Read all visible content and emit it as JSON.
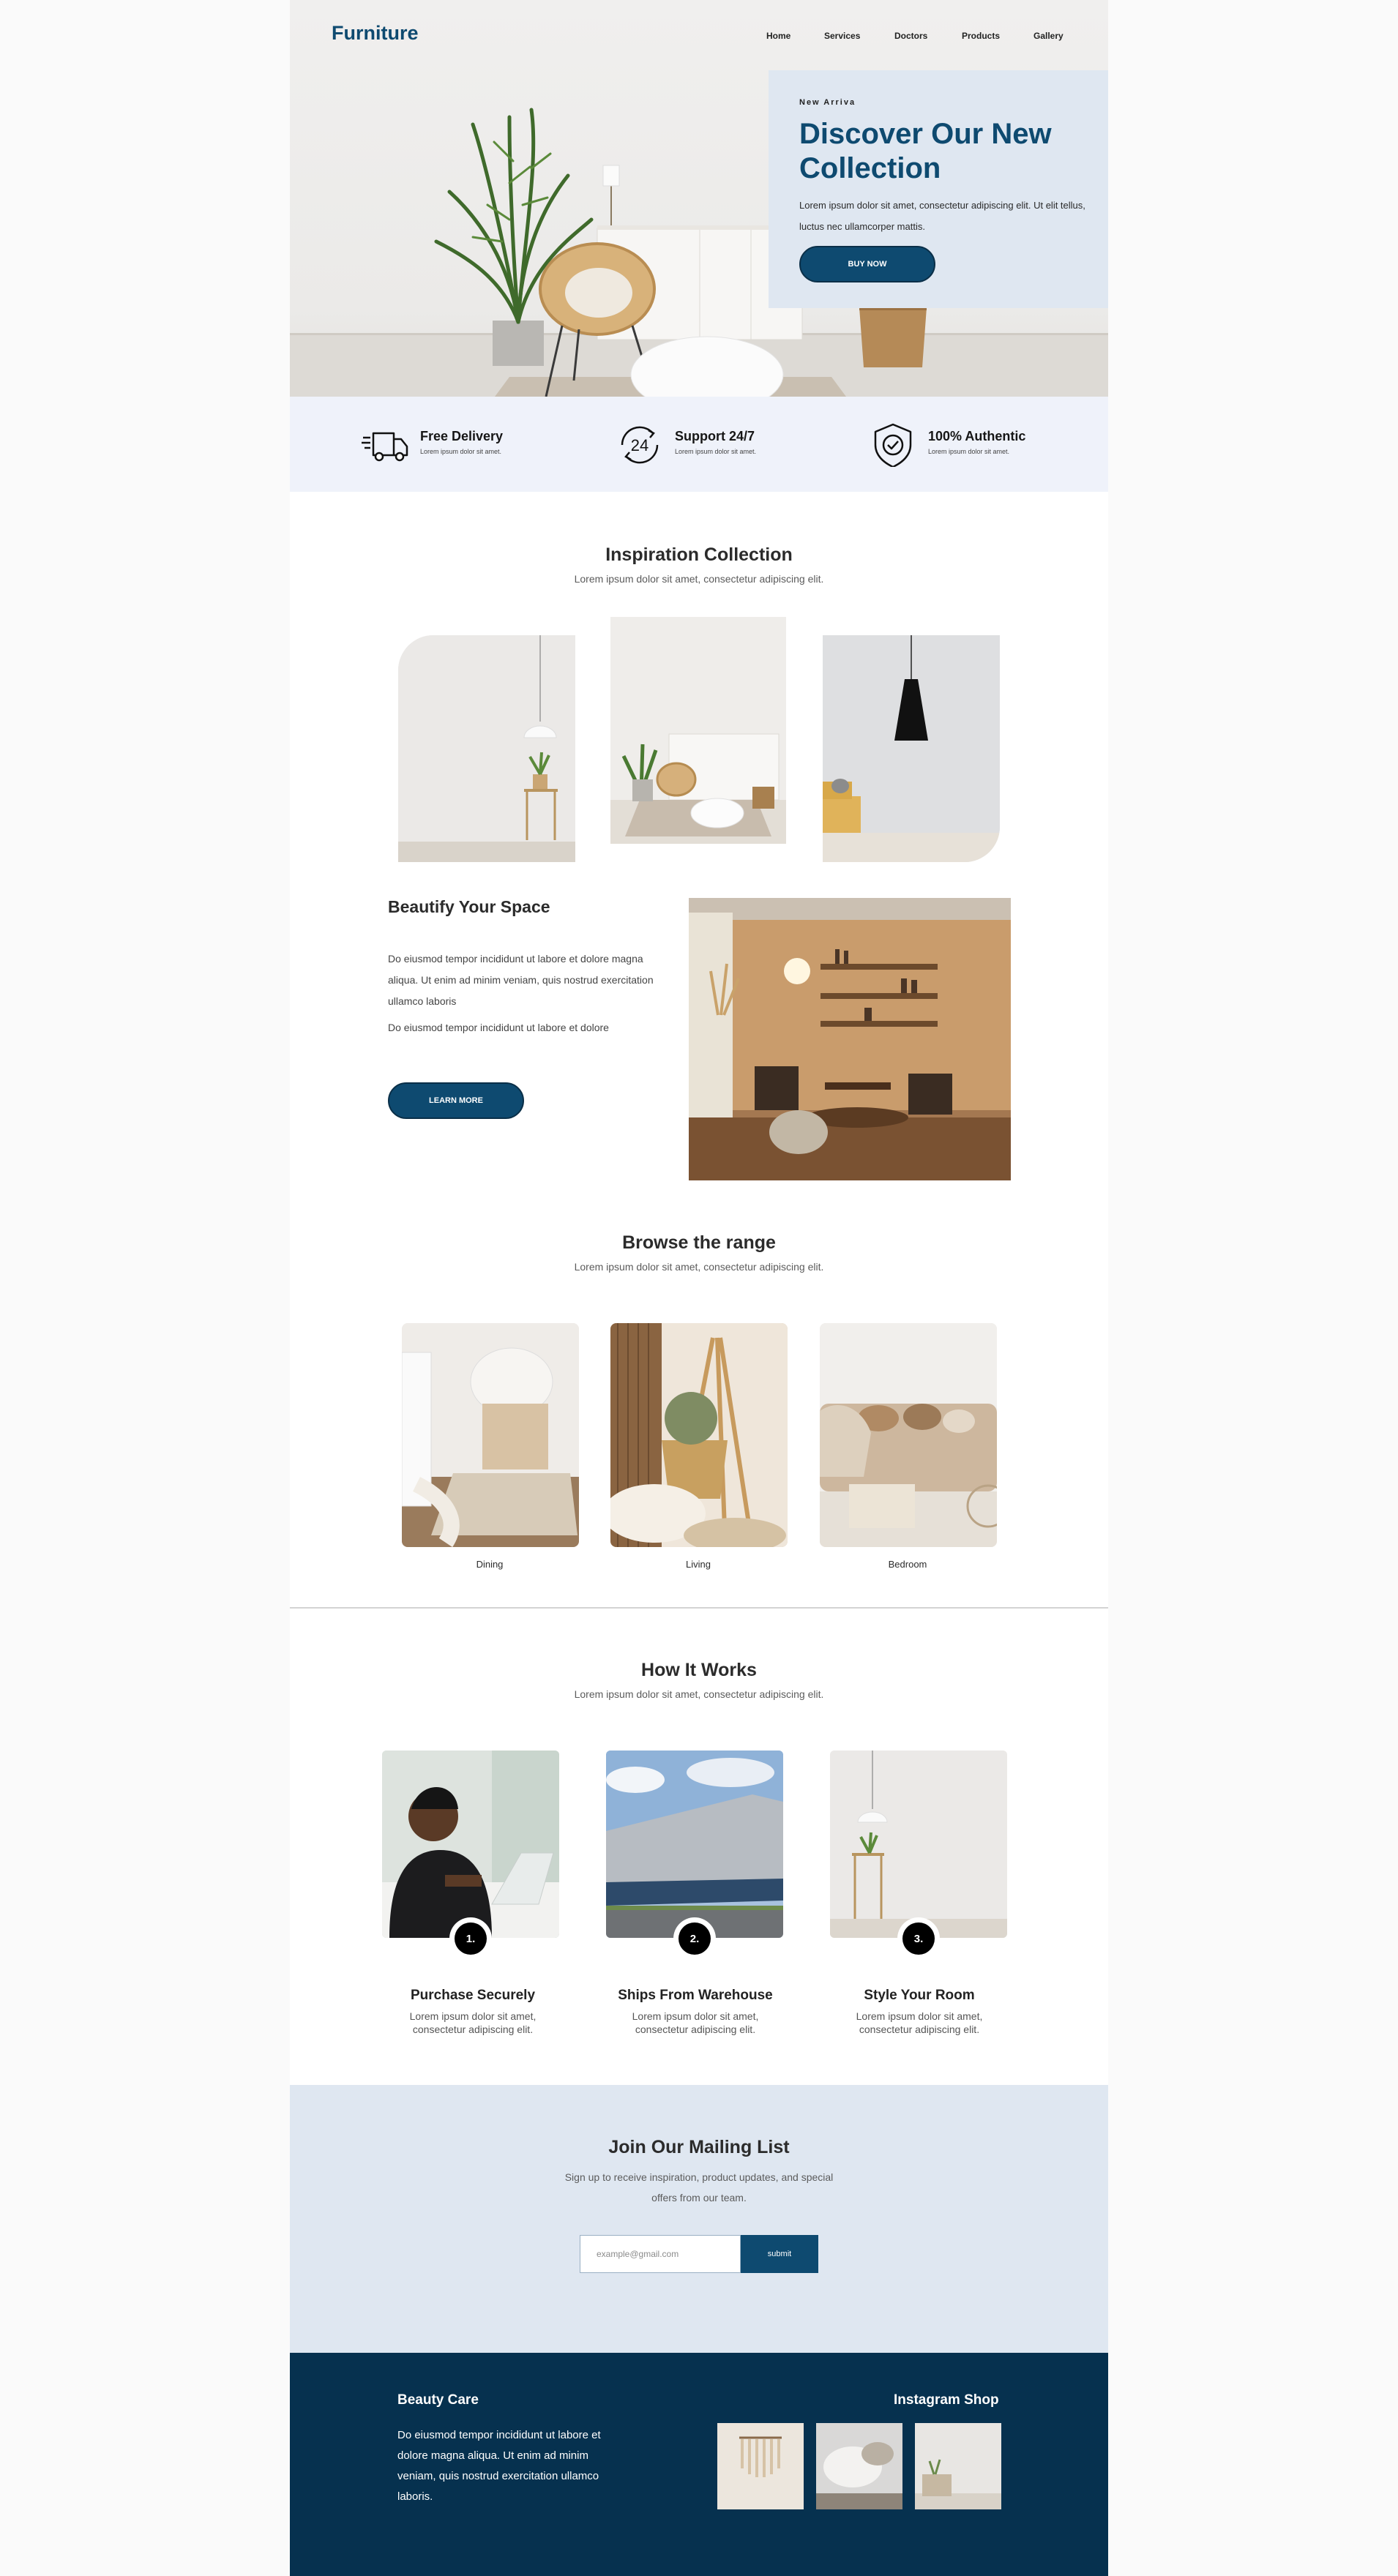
{
  "header": {
    "logo": "Furniture",
    "nav": [
      "Home",
      "Services",
      "Doctors",
      "Products",
      "Gallery"
    ]
  },
  "hero": {
    "eyebrow": "New Arriva",
    "title": "Discover Our New Collection",
    "text": "Lorem ipsum dolor sit amet, consectetur adipiscing elit. Ut elit tellus, luctus nec ullamcorper mattis.",
    "button": "BUY NOW"
  },
  "features": [
    {
      "title": "Free Delivery",
      "sub": "Lorem ipsum dolor sit amet.",
      "icon": "truck-icon"
    },
    {
      "title": "Support 24/7",
      "sub": "Lorem ipsum dolor sit amet.",
      "icon": "support-24-icon"
    },
    {
      "title": "100% Authentic",
      "sub": "Lorem ipsum dolor sit amet.",
      "icon": "shield-check-icon"
    }
  ],
  "inspiration": {
    "title": "Inspiration Collection",
    "subtitle": "Lorem ipsum dolor sit amet, consectetur adipiscing elit."
  },
  "beautify": {
    "title": "Beautify Your Space",
    "para1": "Do eiusmod tempor incididunt ut labore et dolore magna aliqua. Ut enim ad minim veniam, quis nostrud exercitation ullamco laboris",
    "para2": "Do eiusmod tempor incididunt ut labore et dolore",
    "button": "LEARN MORE"
  },
  "browse": {
    "title": "Browse the range",
    "subtitle": "Lorem ipsum dolor sit amet, consectetur adipiscing elit.",
    "items": [
      "Dining",
      "Living",
      "Bedroom"
    ]
  },
  "how": {
    "title": "How It Works",
    "subtitle": "Lorem ipsum dolor sit amet, consectetur adipiscing elit.",
    "steps": [
      {
        "num": "1.",
        "title": "Purchase Securely",
        "text": "Lorem ipsum dolor sit amet, consectetur adipiscing elit."
      },
      {
        "num": "2.",
        "title": "Ships From Warehouse",
        "text": "Lorem ipsum dolor sit amet, consectetur adipiscing elit."
      },
      {
        "num": "3.",
        "title": "Style Your Room",
        "text": "Lorem ipsum dolor sit amet, consectetur adipiscing elit."
      }
    ]
  },
  "mailing": {
    "title": "Join Our Mailing List",
    "text": "Sign up to receive inspiration, product updates, and special offers from our team.",
    "placeholder": "example@gmail.com",
    "button": "submit"
  },
  "footer": {
    "brand_title": "Beauty Care",
    "brand_text": "Do eiusmod tempor incididunt ut labore et dolore magna aliqua. Ut enim ad minim veniam, quis nostrud exercitation ullamco laboris.",
    "instagram_title": "Instagram Shop"
  },
  "colors": {
    "brand": "#0e4a70",
    "hero_card": "#dfe7f1",
    "features_bg": "#eff2fa",
    "footer_bg": "#06314f"
  }
}
